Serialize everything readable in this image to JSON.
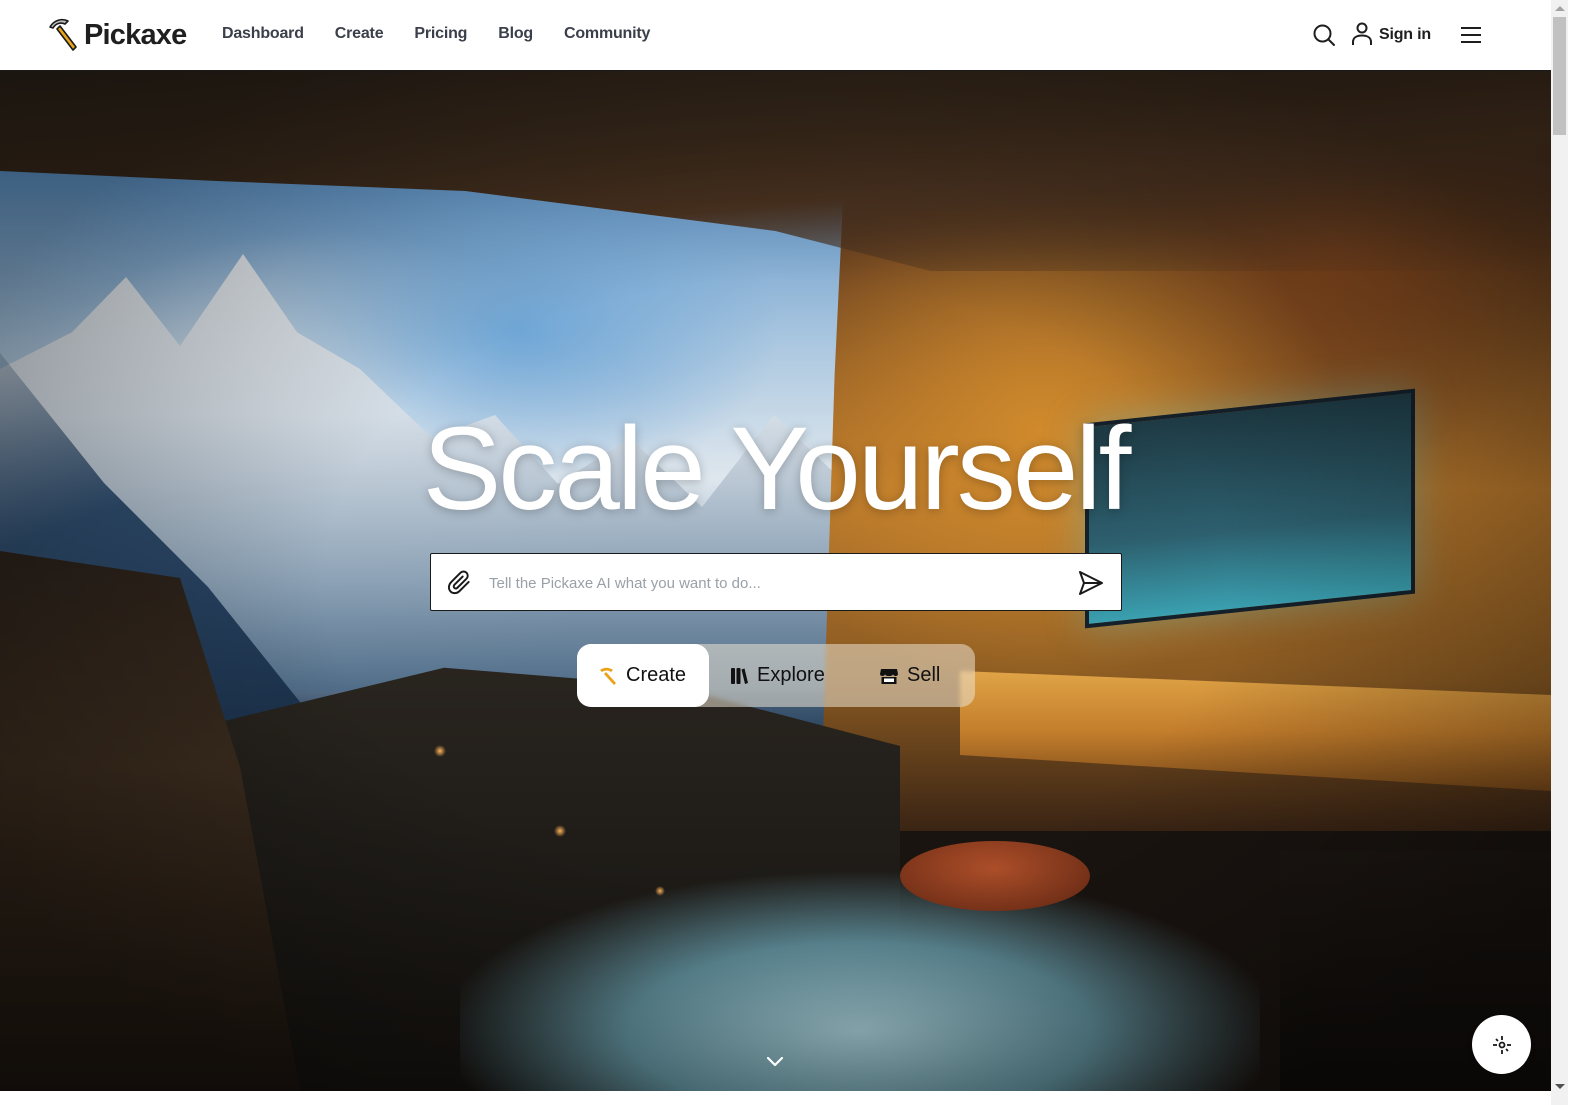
{
  "header": {
    "brand": "Pickaxe",
    "nav": [
      "Dashboard",
      "Create",
      "Pricing",
      "Blog",
      "Community"
    ],
    "signin_label": "Sign in",
    "icons": {
      "logo": "pickaxe-icon",
      "search": "search-icon",
      "user": "user-icon",
      "menu": "hamburger-menu-icon"
    }
  },
  "hero": {
    "title": "Scale Yourself",
    "prompt": {
      "placeholder": "Tell the Pickaxe AI what you want to do...",
      "value": "",
      "attach_icon": "paperclip-icon",
      "send_icon": "send-icon"
    },
    "modes": [
      {
        "label": "Create",
        "icon": "pickaxe-icon",
        "active": true
      },
      {
        "label": "Explore",
        "icon": "library-books-icon",
        "active": false
      },
      {
        "label": "Sell",
        "icon": "storefront-icon",
        "active": false
      }
    ],
    "scroll_hint_icon": "chevron-down-icon"
  },
  "fab": {
    "icon": "crosshair-sparkle-icon"
  },
  "colors": {
    "brand_accent": "#e8a317",
    "nav_text": "#3a3f4a",
    "placeholder": "#9aa0a8"
  }
}
